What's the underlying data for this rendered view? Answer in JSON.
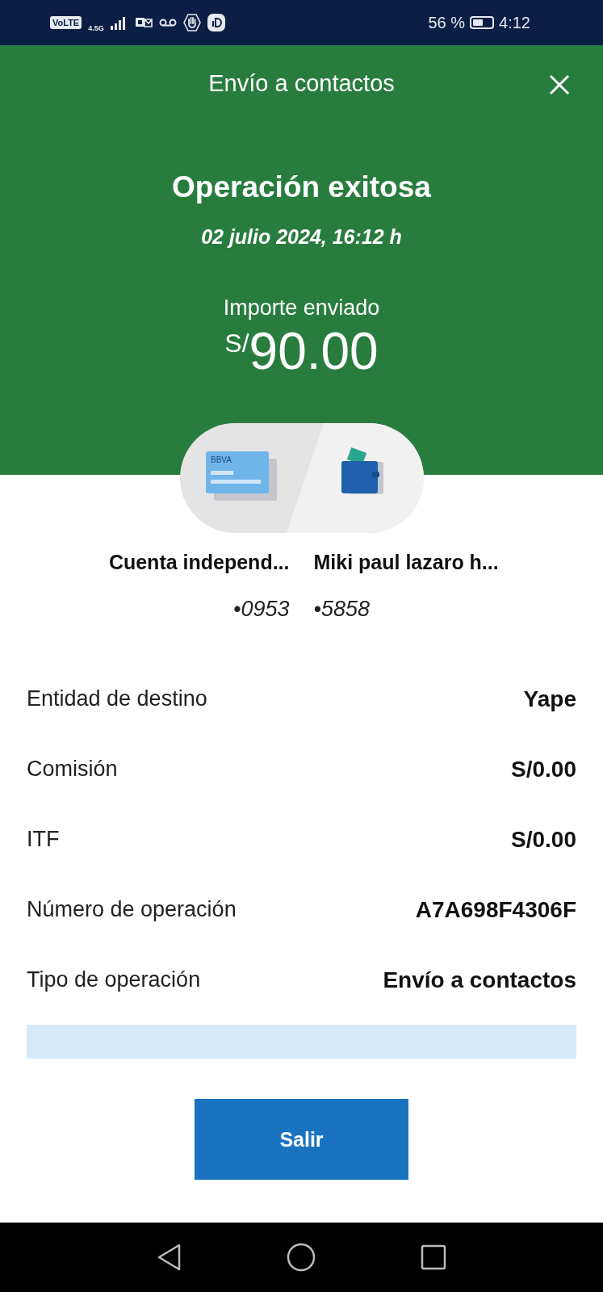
{
  "status_bar": {
    "network_badge": "VoLTE",
    "network_type": "4.5G",
    "battery_percent": "56 %",
    "time": "4:12"
  },
  "header": {
    "title": "Envío a contactos"
  },
  "result": {
    "heading": "Operación exitosa",
    "date": "02 julio 2024, 16:12 h",
    "amount_label": "Importe enviado",
    "currency": "S/",
    "amount": "90.00"
  },
  "transfer": {
    "card_logo": "BBVA",
    "from": {
      "name": "Cuenta independ...",
      "number": "•0953"
    },
    "to": {
      "name": "Miki paul lazaro h...",
      "number": "•5858"
    }
  },
  "details": [
    {
      "label": "Entidad de destino",
      "value": "Yape"
    },
    {
      "label": "Comisión",
      "value": "S/0.00"
    },
    {
      "label": "ITF",
      "value": "S/0.00"
    },
    {
      "label": "Número de operación",
      "value": "A7A698F4306F"
    },
    {
      "label": "Tipo de operación",
      "value": "Envío a contactos"
    }
  ],
  "exit_button": "Salir"
}
